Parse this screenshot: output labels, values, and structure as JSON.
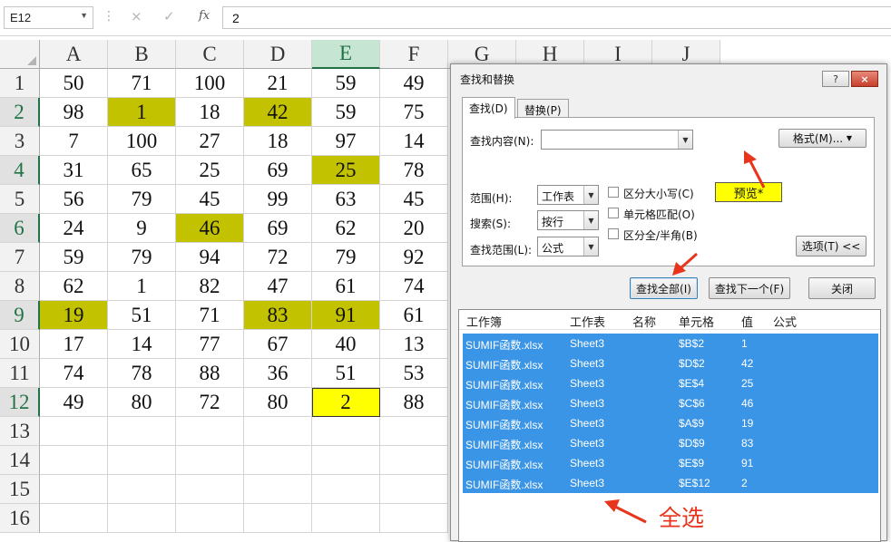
{
  "toolbar": {
    "name_box": "E12",
    "cancel_icon": "×",
    "enter_icon": "✓",
    "fx_label": "fx",
    "formula_value": "2"
  },
  "sheet": {
    "columns": [
      "A",
      "B",
      "C",
      "D",
      "E",
      "F",
      "G",
      "H",
      "I",
      "J"
    ],
    "selected_column": "E",
    "selected_rows": [
      "2",
      "4",
      "6",
      "9",
      "12"
    ],
    "rows": [
      {
        "num": "1",
        "cells": [
          "50",
          "71",
          "100",
          "21",
          "59",
          "49"
        ]
      },
      {
        "num": "2",
        "cells": [
          "98",
          "1",
          "18",
          "42",
          "59",
          "75"
        ]
      },
      {
        "num": "3",
        "cells": [
          "7",
          "100",
          "27",
          "18",
          "97",
          "14"
        ]
      },
      {
        "num": "4",
        "cells": [
          "31",
          "65",
          "25",
          "69",
          "25",
          "78"
        ]
      },
      {
        "num": "5",
        "cells": [
          "56",
          "79",
          "45",
          "99",
          "63",
          "45"
        ]
      },
      {
        "num": "6",
        "cells": [
          "24",
          "9",
          "46",
          "69",
          "62",
          "20"
        ]
      },
      {
        "num": "7",
        "cells": [
          "59",
          "79",
          "94",
          "72",
          "79",
          "92"
        ]
      },
      {
        "num": "8",
        "cells": [
          "62",
          "1",
          "82",
          "47",
          "61",
          "74"
        ]
      },
      {
        "num": "9",
        "cells": [
          "19",
          "51",
          "71",
          "83",
          "91",
          "61"
        ]
      },
      {
        "num": "10",
        "cells": [
          "17",
          "14",
          "77",
          "67",
          "40",
          "13"
        ]
      },
      {
        "num": "11",
        "cells": [
          "74",
          "78",
          "88",
          "36",
          "51",
          "53"
        ]
      },
      {
        "num": "12",
        "cells": [
          "49",
          "80",
          "72",
          "80",
          "2",
          "88"
        ]
      },
      {
        "num": "13",
        "cells": [
          "",
          "",
          "",
          "",
          "",
          ""
        ]
      },
      {
        "num": "14",
        "cells": [
          "",
          "",
          "",
          "",
          "",
          ""
        ]
      },
      {
        "num": "15",
        "cells": [
          "",
          "",
          "",
          "",
          "",
          ""
        ]
      },
      {
        "num": "16",
        "cells": [
          "",
          "",
          "",
          "",
          "",
          ""
        ]
      }
    ],
    "highlight_color": "#c2c200",
    "active_cell_color": "#ffff00"
  },
  "dialog": {
    "title": "查找和替换",
    "help_btn": "?",
    "close_btn": "×",
    "tab_find": "查找(D)",
    "tab_replace": "替换(P)",
    "find_label": "查找内容(N):",
    "find_value": "",
    "preview_label": "预览*",
    "format_btn": "格式(M)...",
    "scope_label": "范围(H):",
    "scope_value": "工作表",
    "search_label": "搜索(S):",
    "search_value": "按行",
    "lookin_label": "查找范围(L):",
    "lookin_value": "公式",
    "match_case": "区分大小写(C)",
    "match_cell": "单元格匹配(O)",
    "match_width": "区分全/半角(B)",
    "options_btn": "选项(T) <<",
    "find_all_btn": "查找全部(I)",
    "find_next_btn": "查找下一个(F)",
    "close_dialog_btn": "关闭",
    "result_headers": [
      "工作簿",
      "工作表",
      "名称",
      "单元格",
      "值",
      "公式"
    ],
    "results": [
      {
        "book": "SUMIF函数.xlsx",
        "sheet": "Sheet3",
        "name": "",
        "cell": "$B$2",
        "value": "1",
        "formula": ""
      },
      {
        "book": "SUMIF函数.xlsx",
        "sheet": "Sheet3",
        "name": "",
        "cell": "$D$2",
        "value": "42",
        "formula": ""
      },
      {
        "book": "SUMIF函数.xlsx",
        "sheet": "Sheet3",
        "name": "",
        "cell": "$E$4",
        "value": "25",
        "formula": ""
      },
      {
        "book": "SUMIF函数.xlsx",
        "sheet": "Sheet3",
        "name": "",
        "cell": "$C$6",
        "value": "46",
        "formula": ""
      },
      {
        "book": "SUMIF函数.xlsx",
        "sheet": "Sheet3",
        "name": "",
        "cell": "$A$9",
        "value": "19",
        "formula": ""
      },
      {
        "book": "SUMIF函数.xlsx",
        "sheet": "Sheet3",
        "name": "",
        "cell": "$D$9",
        "value": "83",
        "formula": ""
      },
      {
        "book": "SUMIF函数.xlsx",
        "sheet": "Sheet3",
        "name": "",
        "cell": "$E$9",
        "value": "91",
        "formula": ""
      },
      {
        "book": "SUMIF函数.xlsx",
        "sheet": "Sheet3",
        "name": "",
        "cell": "$E$12",
        "value": "2",
        "formula": ""
      }
    ],
    "selection_color": "#3b95e6"
  },
  "annotation": {
    "text": "全选",
    "color": "#e8341c"
  }
}
